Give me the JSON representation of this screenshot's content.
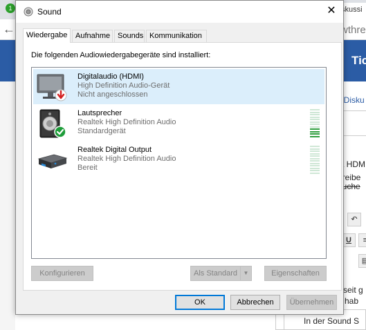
{
  "background": {
    "tab_text": "skussi",
    "url_text": "wthre",
    "banner_text": "Tic",
    "side_text_1": ": Disku",
    "side_text_2": "ia HDM",
    "side_text_3": "hreibe",
    "side_text_4": "auche",
    "side_text_5": "seit g",
    "side_text_6": "n hab",
    "bottom_text": "In der Sound S"
  },
  "dialog": {
    "title": "Sound",
    "close_label": "✕",
    "tabs": [
      {
        "label": "Wiedergabe"
      },
      {
        "label": "Aufnahme"
      },
      {
        "label": "Sounds"
      },
      {
        "label": "Kommunikation"
      }
    ],
    "intro": "Die folgenden Audiowiedergabegeräte sind installiert:",
    "devices": [
      {
        "name": "Digitalaudio (HDMI)",
        "driver": "High Definition Audio-Gerät",
        "status": "Nicht angeschlossen",
        "icon": "monitor-icon",
        "badge": "disconnected-arrow-icon",
        "selected": true
      },
      {
        "name": "Lautsprecher",
        "driver": "Realtek High Definition Audio",
        "status": "Standardgerät",
        "icon": "speaker-icon",
        "badge": "default-check-icon",
        "level": 0.3
      },
      {
        "name": "Realtek Digital Output",
        "driver": "Realtek High Definition Audio",
        "status": "Bereit",
        "icon": "digital-output-icon",
        "level": 0
      }
    ],
    "buttons": {
      "configure": "Konfigurieren",
      "set_default": "Als Standard",
      "properties": "Eigenschaften",
      "ok": "OK",
      "cancel": "Abbrechen",
      "apply": "Übernehmen"
    },
    "colors": {
      "selection": "#dbeefb",
      "meter_on": "#2f9e3e",
      "meter_off": "#cfe7d6",
      "focus": "#0078d7"
    }
  }
}
